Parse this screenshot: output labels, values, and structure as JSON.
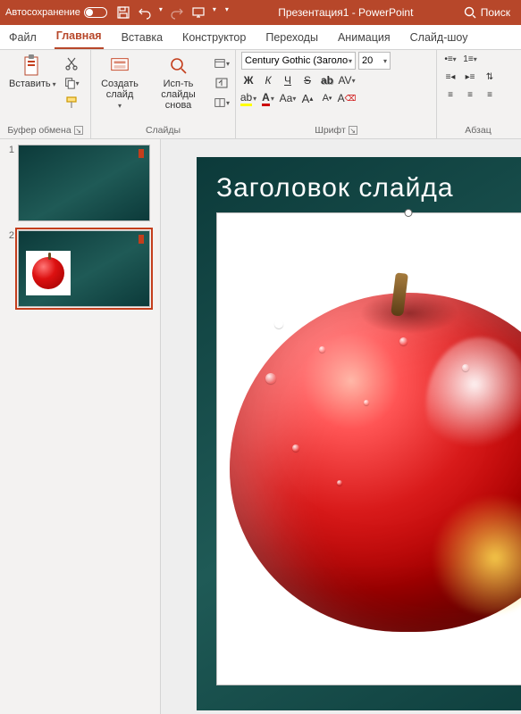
{
  "titlebar": {
    "autosave": "Автосохранение",
    "title": "Презентация1 - PowerPoint",
    "search": "Поиск"
  },
  "tabs": {
    "file": "Файл",
    "home": "Главная",
    "insert": "Вставка",
    "design": "Конструктор",
    "transitions": "Переходы",
    "animations": "Анимация",
    "slideshow": "Слайд-шоу"
  },
  "ribbon": {
    "clipboard": {
      "paste": "Вставить",
      "group": "Буфер обмена"
    },
    "slides": {
      "new_slide": "Создать слайд",
      "reuse": "Исп-ть слайды снова",
      "group": "Слайды"
    },
    "font": {
      "name": "Century Gothic (Заголовки)",
      "size": "20",
      "bold": "Ж",
      "italic": "К",
      "underline": "Ч",
      "strike": "S",
      "case": "Aa",
      "group": "Шрифт"
    },
    "paragraph": {
      "group": "Абзац"
    }
  },
  "thumbnails": {
    "slide1": "1",
    "slide2": "2"
  },
  "slide": {
    "title": "Заголовок слайда"
  },
  "icons": {
    "save": "save-icon",
    "undo": "undo-icon",
    "redo": "redo-icon",
    "present": "present-icon",
    "dropdown": "dropdown-icon",
    "search": "search-icon",
    "paste": "paste-icon",
    "cut": "cut-icon",
    "copy": "copy-icon",
    "format_painter": "format-painter-icon",
    "new_slide": "new-slide-icon",
    "reuse": "reuse-icon",
    "layout": "layout-icon",
    "reset": "reset-icon",
    "section": "section-icon",
    "shadow": "shadow-icon",
    "char_spacing": "char-spacing-icon",
    "highlight": "highlight-icon",
    "font_color": "font-color-icon",
    "clear_format": "clear-format-icon",
    "grow": "grow-font-icon",
    "shrink": "shrink-font-icon",
    "bullets": "bullets-icon",
    "numbering": "numbering-icon",
    "indent_dec": "decrease-indent-icon",
    "indent_inc": "increase-indent-icon",
    "line_spacing": "line-spacing-icon",
    "align_l": "align-left-icon",
    "align_c": "align-center-icon",
    "align_r": "align-right-icon"
  }
}
